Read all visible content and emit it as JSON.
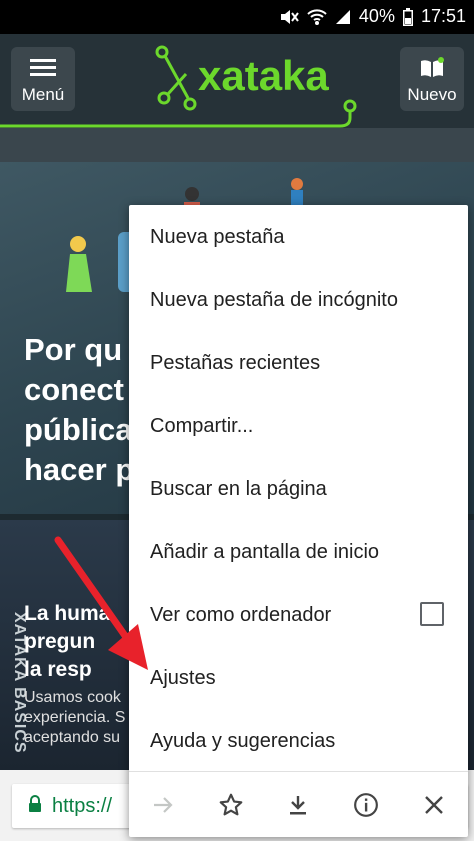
{
  "status_bar": {
    "battery": "40%",
    "time": "17:51"
  },
  "header": {
    "menu_label": "Menú",
    "logo_text": "xataka",
    "new_label": "Nuevo",
    "colors": {
      "brand_green": "#6cd82c",
      "header_bg": "#263238"
    }
  },
  "page": {
    "hero_title_lines": [
      "Por qu",
      "conect",
      "pública",
      "hacer p"
    ],
    "card2_title_lines": [
      "La huma",
      "pregun",
      "la resp"
    ],
    "side_label": "XATAKA BASICS",
    "cookie_lines": [
      "Usamos cook",
      "experiencia. S",
      "aceptando su"
    ]
  },
  "address_bar": {
    "url_text": "https://"
  },
  "menu": {
    "items": [
      {
        "label": "Nueva pestaña"
      },
      {
        "label": "Nueva pestaña de incógnito"
      },
      {
        "label": "Pestañas recientes"
      },
      {
        "label": "Compartir..."
      },
      {
        "label": "Buscar en la página"
      },
      {
        "label": "Añadir a pantalla de inicio"
      },
      {
        "label": "Ver como ordenador",
        "checkbox": false
      },
      {
        "label": "Ajustes"
      },
      {
        "label": "Ayuda y sugerencias"
      }
    ],
    "toolbar_icons": [
      "forward-icon",
      "star-icon",
      "download-icon",
      "info-icon",
      "close-icon"
    ]
  },
  "annotation": {
    "arrow_color": "#e8222b"
  }
}
